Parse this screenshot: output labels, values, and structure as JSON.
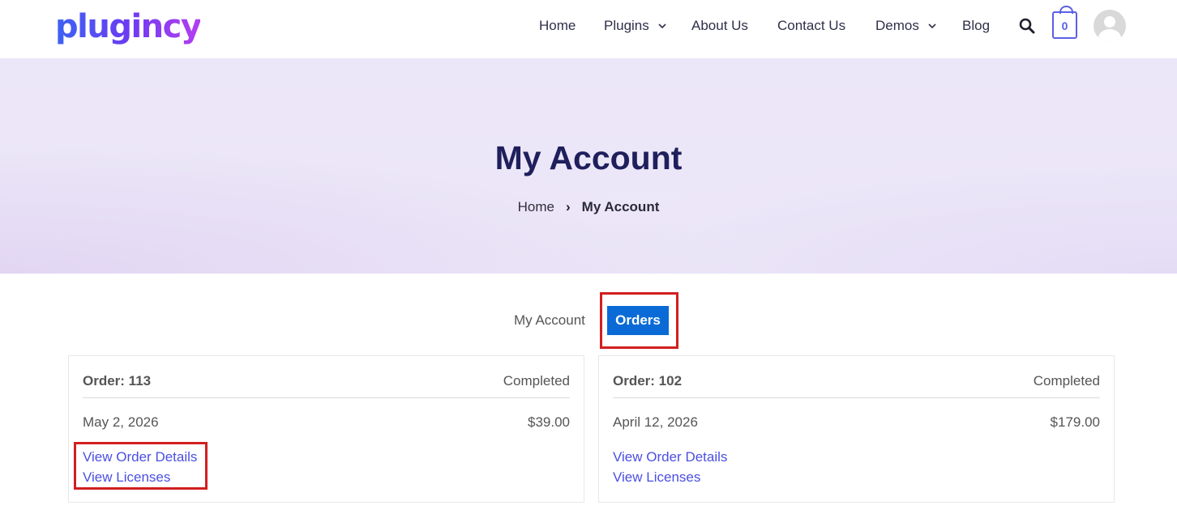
{
  "header": {
    "logo": "plugincy",
    "nav": [
      {
        "label": "Home",
        "dropdown": false
      },
      {
        "label": "Plugins",
        "dropdown": true
      },
      {
        "label": "About Us",
        "dropdown": false
      },
      {
        "label": "Contact Us",
        "dropdown": false
      },
      {
        "label": "Demos",
        "dropdown": true
      },
      {
        "label": "Blog",
        "dropdown": false
      }
    ],
    "search_icon": "search-icon",
    "cart_count": "0"
  },
  "hero": {
    "title": "My Account",
    "breadcrumb": {
      "home": "Home",
      "separator": "›",
      "current": "My Account"
    }
  },
  "tabs": {
    "account": "My Account",
    "orders": "Orders",
    "active": "orders"
  },
  "orders": [
    {
      "order_label": "Order: 113",
      "status": "Completed",
      "date": "May 2, 2026",
      "total": "$39.00",
      "details_link": "View Order Details",
      "licenses_link": "View Licenses"
    },
    {
      "order_label": "Order: 102",
      "status": "Completed",
      "date": "April 12, 2026",
      "total": "$179.00",
      "details_link": "View Order Details",
      "licenses_link": "View Licenses"
    }
  ],
  "colors": {
    "brand_gradient": [
      "#3b63f5",
      "#b43ef0"
    ],
    "active_tab": "#0b6bd6",
    "link": "#4b4fe2",
    "highlight": "#d21f1f",
    "hero_title": "#1f1f5c"
  }
}
